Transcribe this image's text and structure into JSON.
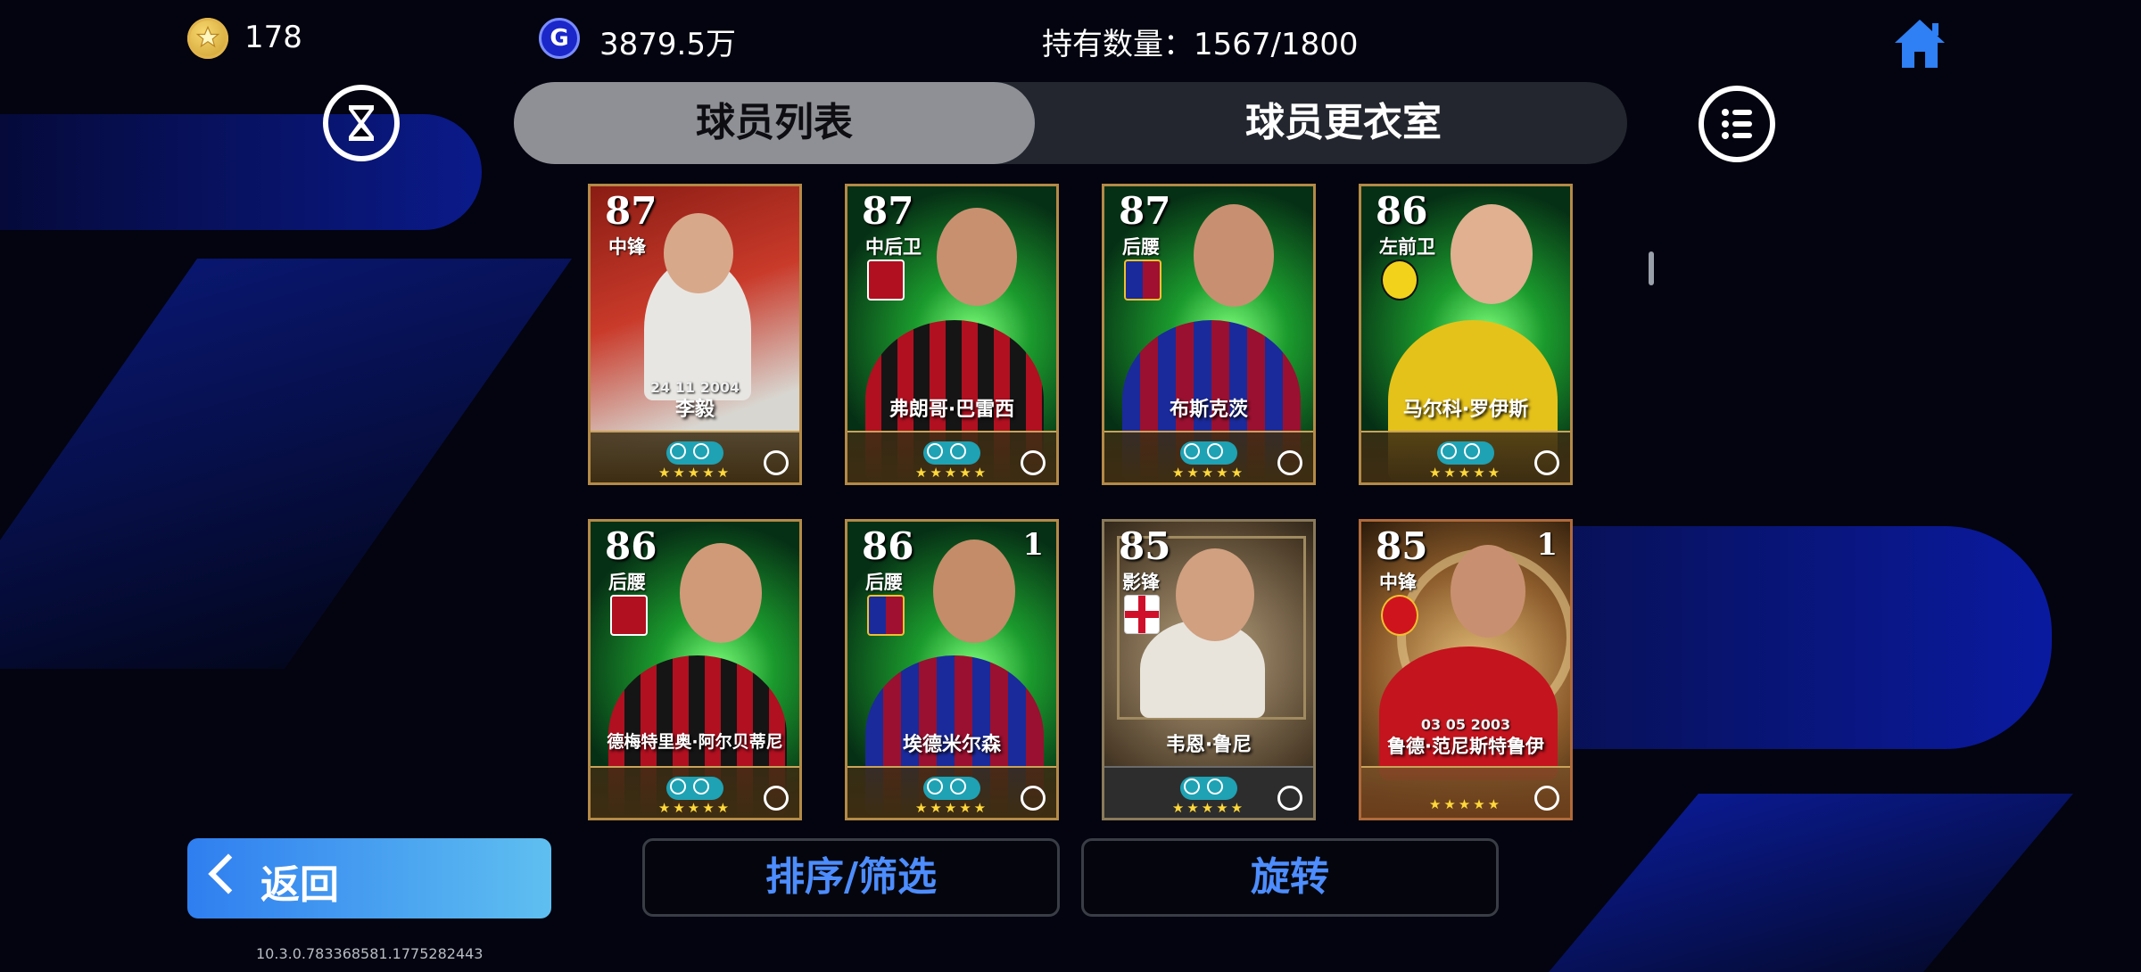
{
  "header": {
    "coins": "178",
    "gp": "3879.5万",
    "count": "持有数量：1567/1800",
    "gp_icon_letter": "G"
  },
  "tabs": [
    {
      "label": "球员列表",
      "active": true
    },
    {
      "label": "球员更衣室",
      "active": false
    }
  ],
  "cards": [
    {
      "rating": "87",
      "position": "中锋",
      "name": "李毅",
      "date": "24 11 2004",
      "badge": "",
      "style": "red"
    },
    {
      "rating": "87",
      "position": "中后卫",
      "name": "弗朗哥·巴雷西",
      "date": "",
      "badge": "",
      "style": "green"
    },
    {
      "rating": "87",
      "position": "后腰",
      "name": "布斯克茨",
      "date": "",
      "badge": "",
      "style": "green"
    },
    {
      "rating": "86",
      "position": "左前卫",
      "name": "马尔科·罗伊斯",
      "date": "",
      "badge": "",
      "style": "green"
    },
    {
      "rating": "86",
      "position": "后腰",
      "name": "德梅特里奥·阿尔贝蒂尼",
      "date": "",
      "badge": "",
      "style": "green"
    },
    {
      "rating": "86",
      "position": "后腰",
      "name": "埃德米尔森",
      "date": "",
      "badge": "1",
      "style": "green"
    },
    {
      "rating": "85",
      "position": "影锋",
      "name": "韦恩·鲁尼",
      "date": "",
      "badge": "",
      "style": "sepia"
    },
    {
      "rating": "85",
      "position": "中锋",
      "name": "鲁德·范尼斯特鲁伊",
      "date": "03 05 2003",
      "badge": "1",
      "style": "bronze"
    }
  ],
  "buttons": {
    "back": "返回",
    "sort": "排序/筛选",
    "rotate": "旋转"
  },
  "version": "10.3.0.783368581.1775282443",
  "colors": {
    "accent_blue": "#4d8dff",
    "back_gradient_start": "#2f7ef0",
    "card_border": "#b48a47"
  }
}
